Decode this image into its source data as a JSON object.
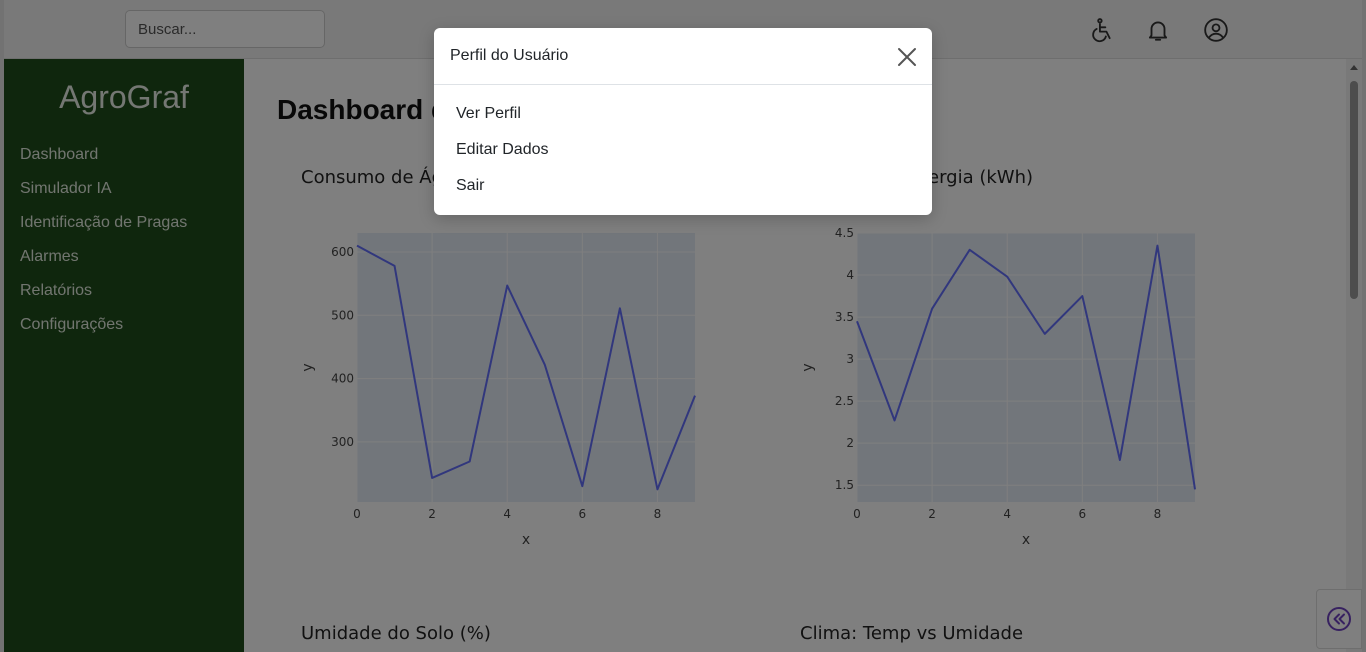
{
  "app": {
    "brand": "AgroGraf",
    "search_placeholder": "Buscar..."
  },
  "topbar": {
    "icons": [
      "accessibility-icon",
      "bell-icon",
      "user-circle-icon"
    ]
  },
  "sidebar": {
    "items": [
      {
        "label": "Dashboard"
      },
      {
        "label": "Simulador IA"
      },
      {
        "label": "Identificação de Pragas"
      },
      {
        "label": "Alarmes"
      },
      {
        "label": "Relatórios"
      },
      {
        "label": "Configurações"
      }
    ]
  },
  "main": {
    "title": "Dashboard d",
    "charts": [
      {
        "title": "Consumo de Ág"
      },
      {
        "title": "ergia (kWh)"
      },
      {
        "title": "Umidade do Solo (%)"
      },
      {
        "title": "Clima: Temp vs Umidade"
      }
    ]
  },
  "modal": {
    "title": "Perfil do Usuário",
    "items": [
      {
        "label": "Ver Perfil"
      },
      {
        "label": "Editar Dados"
      },
      {
        "label": "Sair"
      }
    ]
  },
  "colors": {
    "sidebar_bg": "#1f4d1a",
    "line": "#636efa",
    "plot_bg": "#e5ecf6",
    "accent_purple": "#6f42c1"
  },
  "chart_data": [
    {
      "type": "line",
      "xlabel": "x",
      "ylabel": "y",
      "x": [
        0,
        1,
        2,
        3,
        4,
        5,
        6,
        7,
        8,
        9
      ],
      "series": [
        {
          "values": [
            610,
            578,
            243,
            269,
            547,
            422,
            230,
            511,
            225,
            373
          ]
        }
      ],
      "xlim": [
        0,
        9
      ],
      "ylim": [
        205,
        630
      ],
      "xticks": [
        0,
        2,
        4,
        6,
        8
      ],
      "yticks": [
        300,
        400,
        500,
        600
      ],
      "ytick_labels": [
        "300",
        "400",
        "500",
        "600"
      ],
      "grid": true
    },
    {
      "type": "line",
      "xlabel": "x",
      "ylabel": "y",
      "x": [
        0,
        1,
        2,
        3,
        4,
        5,
        6,
        7,
        8,
        9
      ],
      "series": [
        {
          "values": [
            3.45,
            2.27,
            3.6,
            4.3,
            3.98,
            3.3,
            3.75,
            1.8,
            4.35,
            1.45
          ]
        }
      ],
      "xlim": [
        0,
        9
      ],
      "ylim": [
        1.3,
        4.5
      ],
      "xticks": [
        0,
        2,
        4,
        6,
        8
      ],
      "yticks": [
        1.5,
        2,
        2.5,
        3,
        3.5,
        4,
        4.5
      ],
      "ytick_labels": [
        "1.5",
        "2",
        "2.5",
        "3",
        "3.5",
        "4",
        "4.5"
      ],
      "grid": true
    }
  ]
}
